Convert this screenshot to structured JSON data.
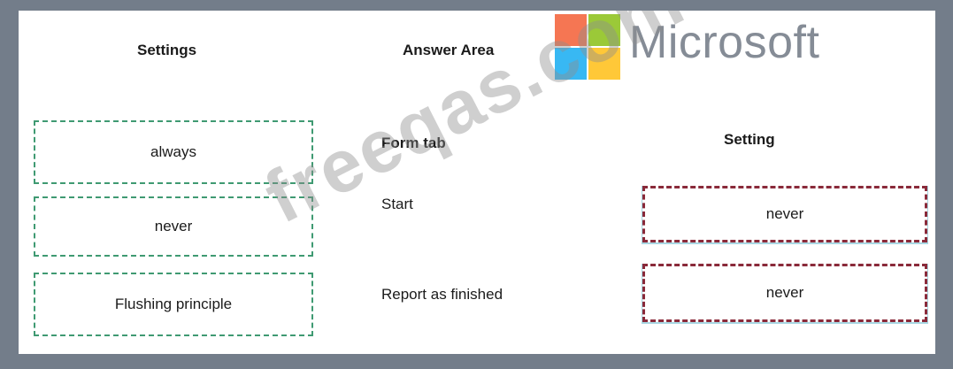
{
  "brand": {
    "word": "Microsoft",
    "colors": [
      "#f25022",
      "#7fba00",
      "#00a4ef",
      "#ffb900"
    ]
  },
  "watermark": "freeqas.com",
  "settings": {
    "heading": "Settings",
    "items": [
      "always",
      "never",
      "Flushing principle"
    ]
  },
  "answer_area": {
    "heading": "Answer Area",
    "form_tab_heading": "Form tab",
    "setting_heading": "Setting",
    "rows": [
      {
        "label": "Start",
        "value": "never"
      },
      {
        "label": "Report as finished",
        "value": "never"
      }
    ]
  }
}
